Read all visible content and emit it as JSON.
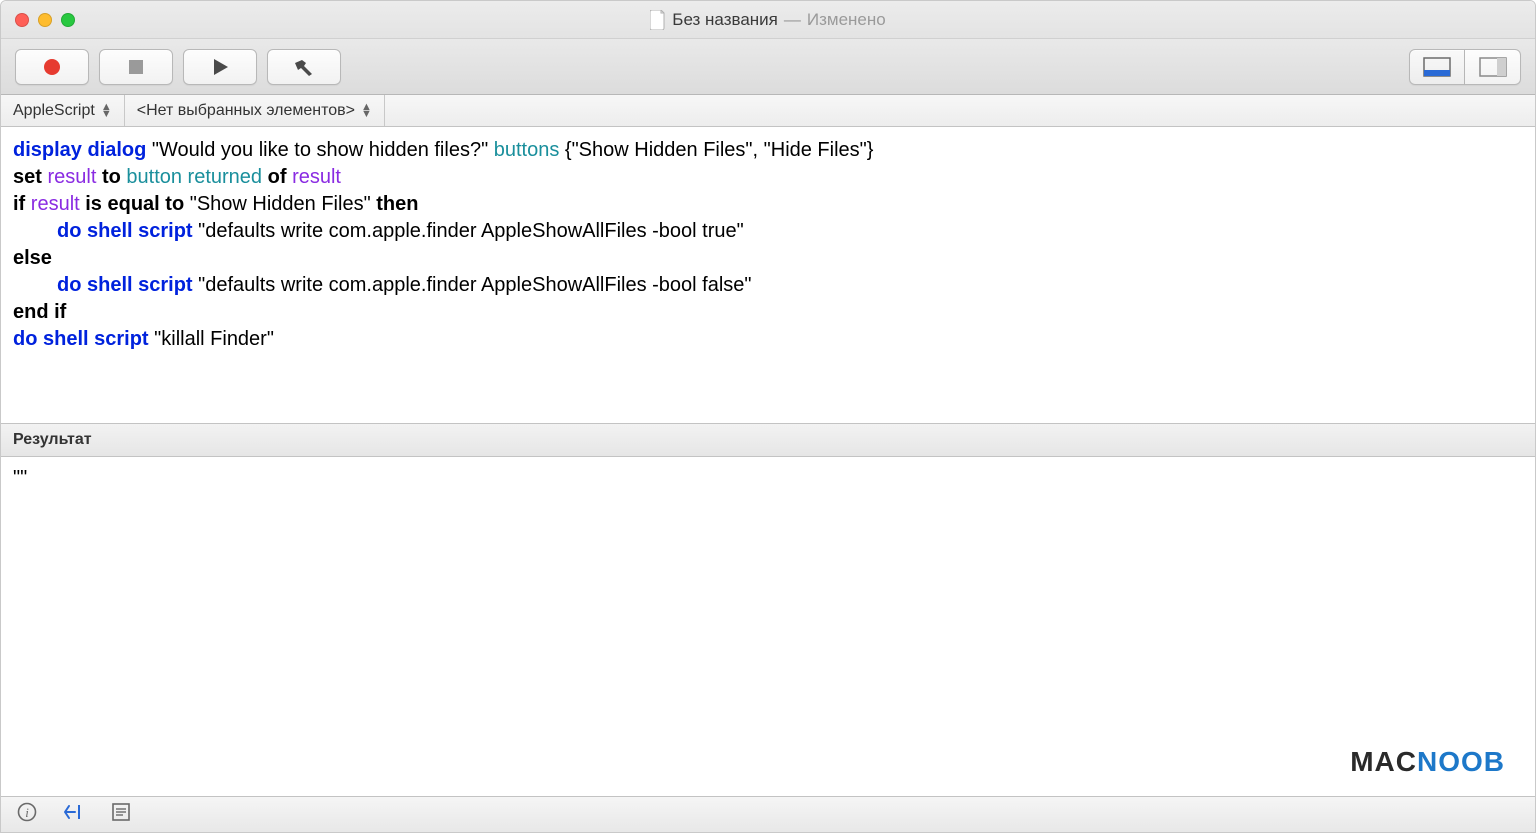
{
  "window": {
    "title": "Без названия",
    "status": "Изменено",
    "separator": " — "
  },
  "toolbar": {
    "record": "record",
    "stop": "stop",
    "play": "play",
    "build": "build",
    "view_bottom": "bottom-panel",
    "view_side": "side-panel"
  },
  "nav": {
    "language": "AppleScript",
    "elements": "<Нет выбранных элементов>"
  },
  "code": {
    "l1_display_dialog": "display dialog",
    "l1_prompt": "\"Would you like to show hidden files?\"",
    "l1_buttons_kw": "buttons",
    "l1_buttons_val": "{\"Show Hidden Files\", \"Hide Files\"}",
    "l2_set": "set",
    "l2_result1": "result",
    "l2_to": "to",
    "l2_button_returned": "button returned",
    "l2_of": "of",
    "l2_result2": "result",
    "l3_if": "if",
    "l3_result": "result",
    "l3_is_equal_to": "is equal to",
    "l3_val": "\"Show Hidden Files\"",
    "l3_then": "then",
    "l4_do_shell": "do shell script",
    "l4_cmd": "\"defaults write com.apple.finder AppleShowAllFiles -bool true\"",
    "l5_else": "else",
    "l6_do_shell": "do shell script",
    "l6_cmd": "\"defaults write com.apple.finder AppleShowAllFiles -bool false\"",
    "l7_endif": "end if",
    "l8_do_shell": "do shell script",
    "l8_cmd": "\"killall Finder\""
  },
  "result": {
    "header": "Результат",
    "value": "\"\""
  },
  "watermark": {
    "part1": "MAC",
    "part2": "NOOB"
  }
}
